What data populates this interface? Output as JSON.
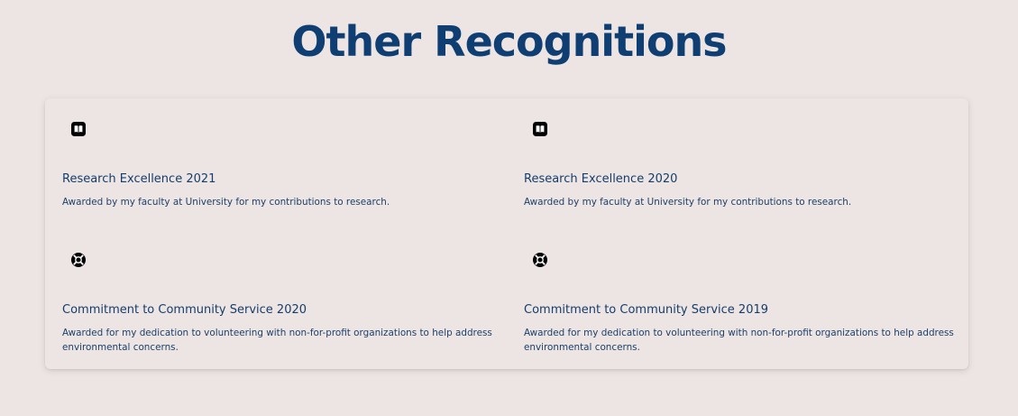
{
  "page": {
    "title": "Other Recognitions"
  },
  "recognitions": [
    {
      "icon": "book-icon",
      "title": "Research Excellence 2021",
      "description": "Awarded by my faculty at University for my contributions to research."
    },
    {
      "icon": "book-icon",
      "title": "Research Excellence 2020",
      "description": "Awarded by my faculty at University for my contributions to research."
    },
    {
      "icon": "lifebuoy-icon",
      "title": "Commitment to Community Service 2020",
      "description": "Awarded for my dedication to volunteering with non-for-profit organizations to help address environmental concerns."
    },
    {
      "icon": "lifebuoy-icon",
      "title": "Commitment to Community Service 2019",
      "description": "Awarded for my dedication to volunteering with non-for-profit organizations to help address environmental concerns."
    }
  ],
  "colors": {
    "background": "#ede5e3",
    "heading": "#0f3e72",
    "text": "#153d6b"
  }
}
